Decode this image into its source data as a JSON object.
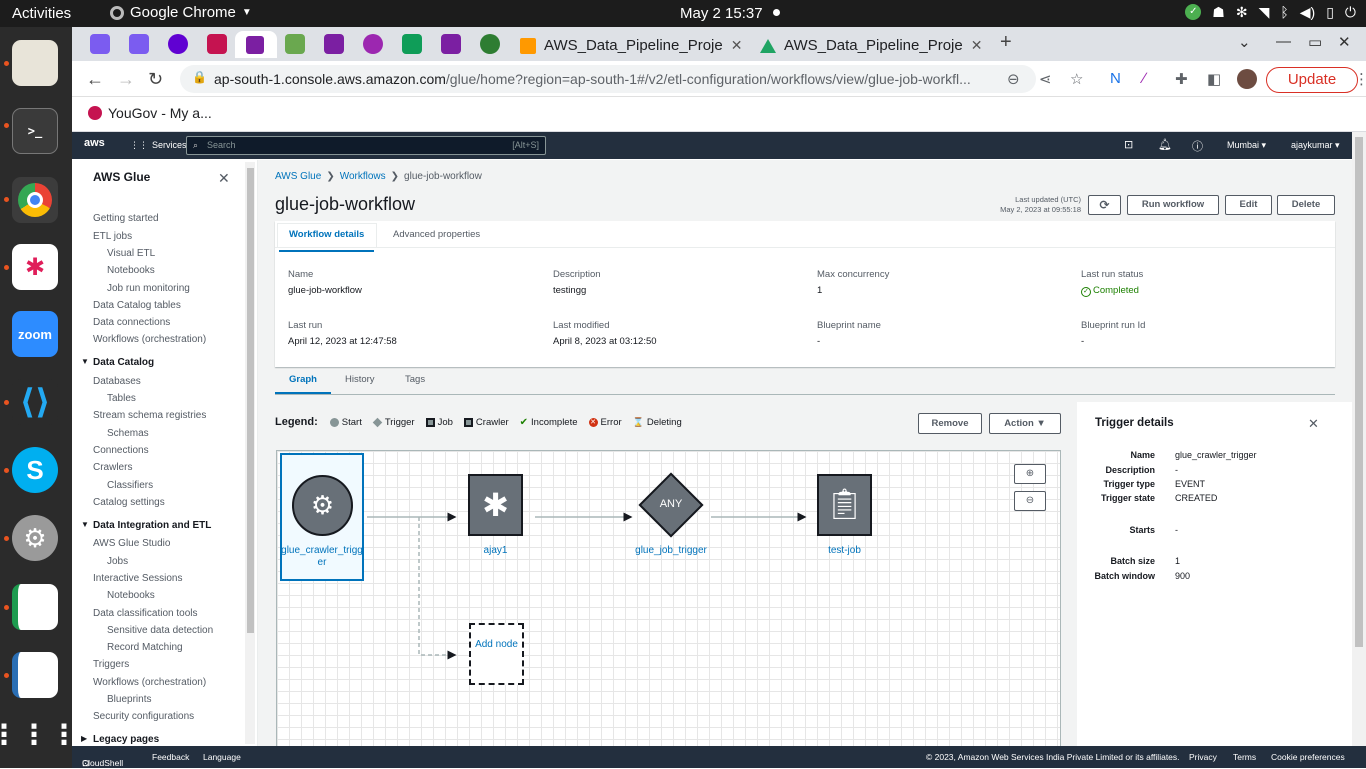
{
  "os": {
    "activities": "Activities",
    "app_name": "Google Chrome",
    "clock": "May 2  15:37"
  },
  "browser": {
    "tabs": [
      {
        "title": "AWS_Data_Pipeline_Proje"
      },
      {
        "title": "AWS_Data_Pipeline_Proje"
      }
    ],
    "url_host": "ap-south-1.console.aws.amazon.com",
    "url_path": "/glue/home?region=ap-south-1#/v2/etl-configuration/workflows/view/glue-job-workfl...",
    "update_label": "Update",
    "bookmark": "YouGov - My a..."
  },
  "aws_nav": {
    "logo": "aws",
    "services": "Services",
    "search_placeholder": "Search",
    "search_shortcut": "[Alt+S]",
    "region": "Mumbai ▾",
    "user": "ajaykumar ▾"
  },
  "sidebar": {
    "title": "AWS Glue",
    "items": [
      {
        "label": "Getting started",
        "level": "top"
      },
      {
        "label": "ETL jobs",
        "level": "top"
      },
      {
        "label": "Visual ETL",
        "level": "sub"
      },
      {
        "label": "Notebooks",
        "level": "sub"
      },
      {
        "label": "Job run monitoring",
        "level": "sub"
      },
      {
        "label": "Data Catalog tables",
        "level": "top"
      },
      {
        "label": "Data connections",
        "level": "top"
      },
      {
        "label": "Workflows (orchestration)",
        "level": "top"
      },
      {
        "label": "Data Catalog",
        "level": "sec"
      },
      {
        "label": "Databases",
        "level": "top"
      },
      {
        "label": "Tables",
        "level": "sub"
      },
      {
        "label": "Stream schema registries",
        "level": "top"
      },
      {
        "label": "Schemas",
        "level": "sub"
      },
      {
        "label": "Connections",
        "level": "top"
      },
      {
        "label": "Crawlers",
        "level": "top"
      },
      {
        "label": "Classifiers",
        "level": "sub"
      },
      {
        "label": "Catalog settings",
        "level": "top"
      },
      {
        "label": "Data Integration and ETL",
        "level": "sec"
      },
      {
        "label": "AWS Glue Studio",
        "level": "top"
      },
      {
        "label": "Jobs",
        "level": "sub"
      },
      {
        "label": "Interactive Sessions",
        "level": "top"
      },
      {
        "label": "Notebooks",
        "level": "sub"
      },
      {
        "label": "Data classification tools",
        "level": "top"
      },
      {
        "label": "Sensitive data detection",
        "level": "sub"
      },
      {
        "label": "Record Matching",
        "level": "sub"
      },
      {
        "label": "Triggers",
        "level": "top"
      },
      {
        "label": "Workflows (orchestration)",
        "level": "top"
      },
      {
        "label": "Blueprints",
        "level": "sub"
      },
      {
        "label": "Security configurations",
        "level": "top"
      },
      {
        "label": "Legacy pages",
        "level": "sec-collapsed"
      }
    ]
  },
  "breadcrumb": [
    "AWS Glue",
    "Workflows",
    "glue-job-workflow"
  ],
  "page_title": "glue-job-workflow",
  "last_updated_label": "Last updated (UTC)",
  "last_updated_value": "May 2, 2023 at 09:55:18",
  "actions": {
    "refresh": "⟳",
    "run": "Run workflow",
    "edit": "Edit",
    "delete": "Delete"
  },
  "detail_tabs": [
    "Workflow details",
    "Advanced properties"
  ],
  "details": {
    "name_label": "Name",
    "name": "glue-job-workflow",
    "desc_label": "Description",
    "desc": "testingg",
    "maxc_label": "Max concurrency",
    "maxc": "1",
    "status_label": "Last run status",
    "status": "Completed",
    "lastrun_label": "Last run",
    "lastrun": "April 12, 2023 at 12:47:58",
    "modified_label": "Last modified",
    "modified": "April 8, 2023 at 03:12:50",
    "bp_label": "Blueprint name",
    "bp": "-",
    "bprun_label": "Blueprint run Id",
    "bprun": "-"
  },
  "graph_tabs": [
    "Graph",
    "History",
    "Tags"
  ],
  "legend": {
    "title": "Legend:",
    "items": [
      "Start",
      "Trigger",
      "Job",
      "Crawler",
      "Incomplete",
      "Error",
      "Deleting"
    ]
  },
  "graph_actions": {
    "remove": "Remove",
    "action": "Action ▼"
  },
  "nodes": {
    "start": "glue_crawler_trigger",
    "crawler": "ajay1",
    "trigger": "glue_job_trigger",
    "trigger_badge": "ANY",
    "job": "test-job",
    "add": "Add node"
  },
  "trigger_details": {
    "title": "Trigger details",
    "rows": [
      {
        "k": "Name",
        "v": "glue_crawler_trigger"
      },
      {
        "k": "Description",
        "v": "-"
      },
      {
        "k": "Trigger type",
        "v": "EVENT"
      },
      {
        "k": "Trigger state",
        "v": "CREATED"
      },
      {
        "k": "Starts",
        "v": "-"
      },
      {
        "k": "Batch size",
        "v": "1"
      },
      {
        "k": "Batch window",
        "v": "900"
      }
    ]
  },
  "footer": {
    "cloudshell": "CloudShell",
    "feedback": "Feedback",
    "language": "Language",
    "copyright": "© 2023, Amazon Web Services India Private Limited or its affiliates.",
    "privacy": "Privacy",
    "terms": "Terms",
    "cookies": "Cookie preferences"
  }
}
